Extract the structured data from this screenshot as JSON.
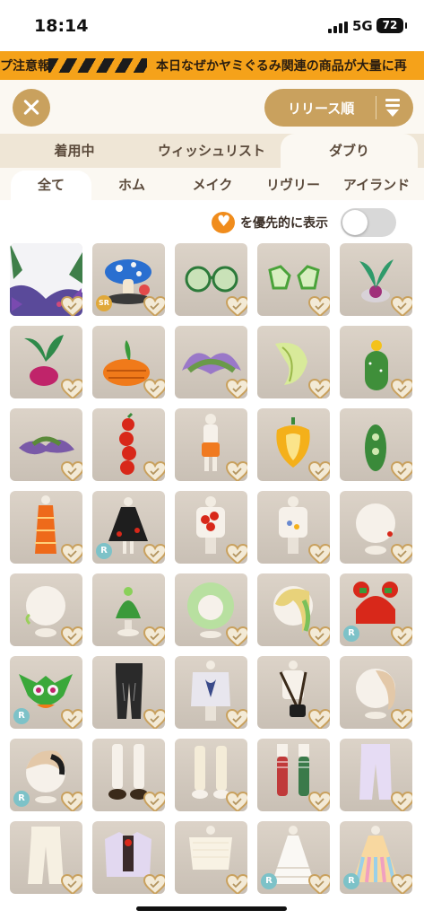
{
  "status_bar": {
    "time": "18:14",
    "network": "5G",
    "battery": "72"
  },
  "ticker": {
    "text_left": "プ注意報",
    "text_right": "本日なぜかヤミぐるみ関連の商品が大量に再"
  },
  "header": {
    "close_icon": "close-icon",
    "sort_label": "リリース順",
    "sort_icon": "sort-icon"
  },
  "tabs": [
    {
      "label": "着用中"
    },
    {
      "label": "ウィッシュリスト"
    },
    {
      "label": "ダブり",
      "active": true
    }
  ],
  "subtabs": [
    {
      "label": "全て",
      "active": true
    },
    {
      "label": "ホム"
    },
    {
      "label": "メイク"
    },
    {
      "label": "リヴリー"
    },
    {
      "label": "アイランド"
    }
  ],
  "priority": {
    "label": "を優先的に表示",
    "toggle_on": false,
    "heart_color": "#f08c1c"
  },
  "colors": {
    "accent": "#c9a15e",
    "ticker": "#f5a21a",
    "rarity_r": "#7dc2c8",
    "rarity_sr": "#e0a83a"
  },
  "grid": {
    "items": [
      {
        "art": "jungle",
        "badge": ""
      },
      {
        "art": "mushroom",
        "badge": "SR"
      },
      {
        "art": "glasses-round",
        "badge": ""
      },
      {
        "art": "glasses-flower",
        "badge": ""
      },
      {
        "art": "turnip-plant",
        "badge": ""
      },
      {
        "art": "beet",
        "badge": ""
      },
      {
        "art": "carrot",
        "badge": ""
      },
      {
        "art": "purple-leaves",
        "badge": ""
      },
      {
        "art": "cabbage-leaf",
        "badge": ""
      },
      {
        "art": "cactus",
        "badge": ""
      },
      {
        "art": "purple-sprout",
        "badge": ""
      },
      {
        "art": "tomato-chain",
        "badge": ""
      },
      {
        "art": "orange-shorts-outfit",
        "badge": ""
      },
      {
        "art": "yellow-pepper",
        "badge": ""
      },
      {
        "art": "green-pod",
        "badge": ""
      },
      {
        "art": "orange-dress",
        "badge": ""
      },
      {
        "art": "black-dress",
        "badge": "R"
      },
      {
        "art": "tomato-top",
        "badge": ""
      },
      {
        "art": "white-top-pins",
        "badge": ""
      },
      {
        "art": "head-hair-clip",
        "badge": ""
      },
      {
        "art": "head-green-ears",
        "badge": ""
      },
      {
        "art": "sprout-hat",
        "badge": ""
      },
      {
        "art": "lettuce-hair",
        "badge": ""
      },
      {
        "art": "blond-green-hair",
        "badge": ""
      },
      {
        "art": "red-bun-hair",
        "badge": "R"
      },
      {
        "art": "green-gremlin",
        "badge": "R"
      },
      {
        "art": "black-pants",
        "badge": ""
      },
      {
        "art": "graphic-tee",
        "badge": ""
      },
      {
        "art": "black-bag",
        "badge": ""
      },
      {
        "art": "beige-hair",
        "badge": ""
      },
      {
        "art": "beige-black-hair",
        "badge": "R"
      },
      {
        "art": "white-socks-shoes",
        "badge": ""
      },
      {
        "art": "cream-socks",
        "badge": ""
      },
      {
        "art": "red-green-socks",
        "badge": ""
      },
      {
        "art": "lavender-pants",
        "badge": ""
      },
      {
        "art": "cream-pants",
        "badge": ""
      },
      {
        "art": "lilac-jacket",
        "badge": ""
      },
      {
        "art": "cream-sweater",
        "badge": ""
      },
      {
        "art": "lace-dress",
        "badge": "R"
      },
      {
        "art": "rainbow-dress",
        "badge": "R"
      }
    ]
  }
}
